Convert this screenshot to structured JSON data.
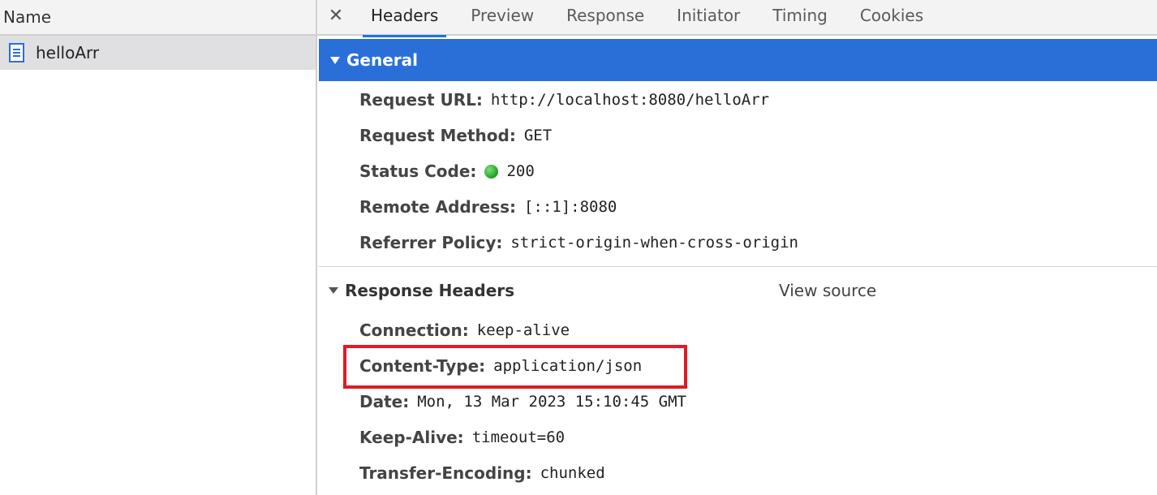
{
  "request_list": {
    "header": "Name",
    "items": [
      {
        "label": "helloArr",
        "icon": "document-icon"
      }
    ]
  },
  "tabs": [
    "Headers",
    "Preview",
    "Response",
    "Initiator",
    "Timing",
    "Cookies"
  ],
  "active_tab": "Headers",
  "general": {
    "title": "General",
    "rows": [
      {
        "key": "Request URL:",
        "value": "http://localhost:8080/helloArr"
      },
      {
        "key": "Request Method:",
        "value": "GET"
      },
      {
        "key": "Status Code:",
        "value": "200"
      },
      {
        "key": "Remote Address:",
        "value": "[::1]:8080"
      },
      {
        "key": "Referrer Policy:",
        "value": "strict-origin-when-cross-origin"
      }
    ]
  },
  "response_headers": {
    "title": "Response Headers",
    "view_source": "View source",
    "rows": [
      {
        "key": "Connection:",
        "value": "keep-alive"
      },
      {
        "key": "Content-Type:",
        "value": "application/json"
      },
      {
        "key": "Date:",
        "value": "Mon, 13 Mar 2023 15:10:45 GMT"
      },
      {
        "key": "Keep-Alive:",
        "value": "timeout=60"
      },
      {
        "key": "Transfer-Encoding:",
        "value": "chunked"
      }
    ]
  },
  "colors": {
    "section_bar": "#2a6fd8",
    "active_tab_underline": "#1a73e8",
    "status_ok": "#1e9e1e",
    "highlight_box": "#e01b24"
  }
}
